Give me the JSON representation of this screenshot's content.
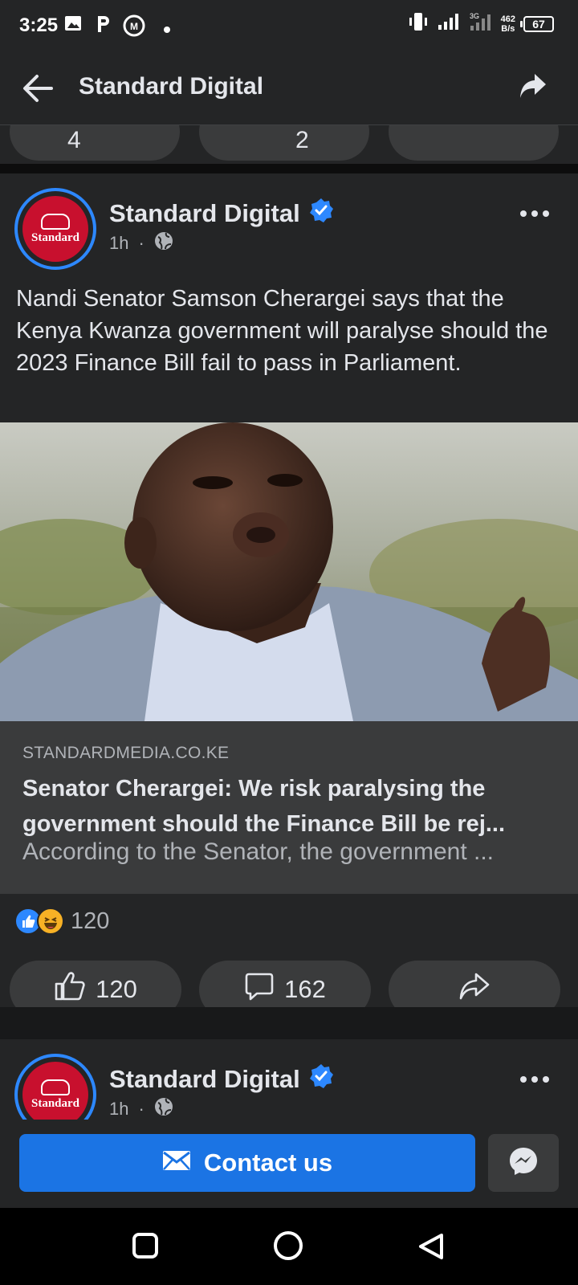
{
  "status_bar": {
    "time": "3:25",
    "network_speed_value": "462",
    "network_speed_unit": "B/s",
    "battery": "67",
    "network_type": "3G"
  },
  "header": {
    "title": "Standard Digital",
    "back_icon": "arrow-left-icon",
    "share_icon": "share-arrow-icon"
  },
  "previous_post": {
    "like_count": "4",
    "comment_count": "2"
  },
  "post": {
    "page_name": "Standard Digital",
    "verified": true,
    "time_ago": "1h",
    "audience_icon": "globe-icon",
    "avatar_label": "Standard",
    "text": "Nandi Senator Samson Cherargei says that the Kenya Kwanza government will paralyse should the 2023 Finance Bill fail to pass in Parliament.",
    "link": {
      "domain": "STANDARDMEDIA.CO.KE",
      "title": "Senator Cherargei: We risk paralysing the government should the Finance Bill be rej...",
      "description": "According to the Senator, the government ..."
    },
    "reactions": {
      "types": [
        "like",
        "haha"
      ],
      "total": "120"
    },
    "actions": {
      "likes": "120",
      "comments": "162",
      "share_icon": "share-icon"
    }
  },
  "next_post": {
    "page_name": "Standard Digital",
    "time_ago": "1h",
    "avatar_label": "Standard"
  },
  "contact_bar": {
    "button_label": "Contact us",
    "messenger_icon": "messenger-icon"
  },
  "colors": {
    "background": "#242526",
    "accent": "#1b74e4",
    "verified": "#2d88ff",
    "brand_red": "#c8102e"
  }
}
